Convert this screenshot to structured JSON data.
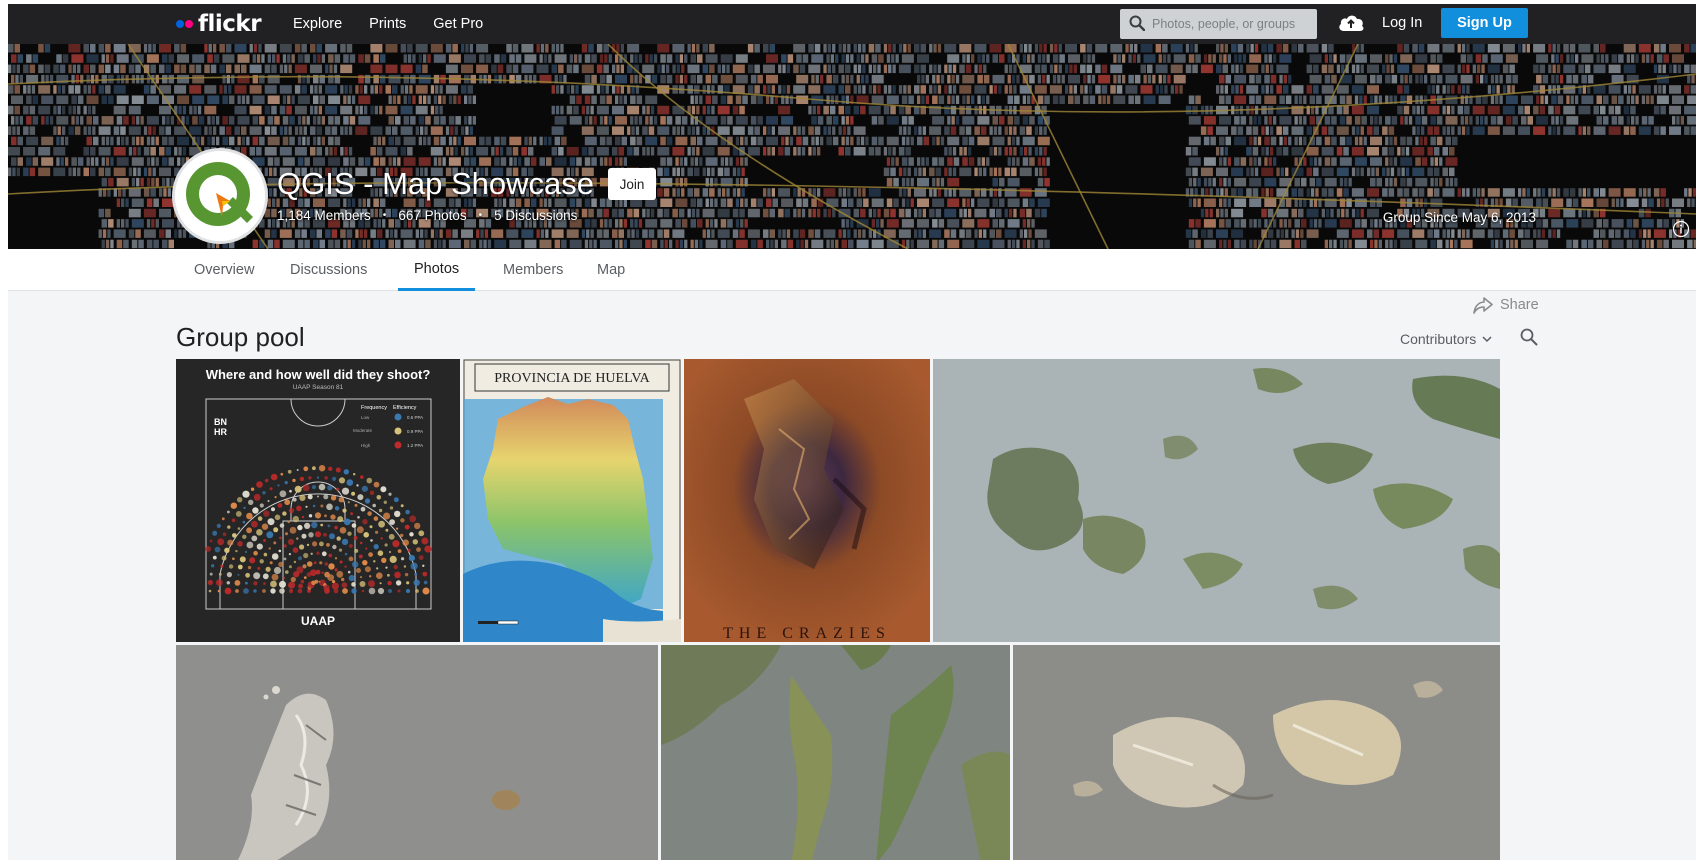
{
  "nav": {
    "logo_text": "flickr",
    "links": [
      "Explore",
      "Prints",
      "Get Pro"
    ],
    "search_placeholder": "Photos, people, or groups",
    "login": "Log In",
    "signup": "Sign Up"
  },
  "group": {
    "title": "QGIS - Map Showcase",
    "join": "Join",
    "members": "1,184 Members",
    "photos": "667 Photos",
    "discussions": "5 Discussions",
    "separator": "•",
    "since": "Group Since May 6, 2013"
  },
  "tabs": [
    "Overview",
    "Discussions",
    "Photos",
    "Members",
    "Map"
  ],
  "active_tab": "Photos",
  "pool": {
    "share": "Share",
    "title": "Group pool",
    "contributors": "Contributors"
  },
  "photos": {
    "p1": {
      "title": "Where and how well did they shoot?",
      "subtitle": "UAAP Season 81",
      "team1": "BN",
      "team2": "HR",
      "legend_freq": "Frequency",
      "legend_eff": "Efficiency",
      "legend_low": "Low",
      "legend_mod": "Moderate",
      "legend_high": "High",
      "eff_1": "0.6 PPA",
      "eff_2": "0.9 PPA",
      "eff_3": "1.2 PPA",
      "footer": "UAAP"
    },
    "p2": {
      "title": "PROVINCIA DE HUELVA"
    },
    "p3": {
      "title": "THE CRAZIES"
    }
  },
  "colors": {
    "nav_bg": "#212124",
    "accent_blue": "#128fdc",
    "logo_blue": "#0063dc",
    "logo_pink": "#ff0084",
    "page_bg": "#f3f5f6"
  }
}
